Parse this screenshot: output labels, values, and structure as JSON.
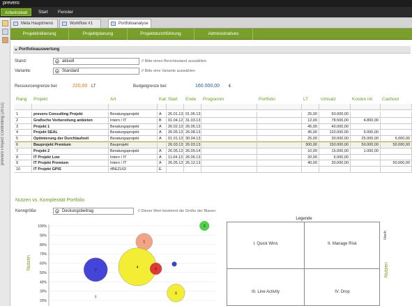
{
  "window": {
    "title": "prevero"
  },
  "menu": [
    {
      "label": "Arbeitsblatt",
      "active": true
    },
    {
      "label": "Start",
      "active": false
    },
    {
      "label": "Fenster",
      "active": false
    }
  ],
  "side": {
    "vertical_text": "prevero Project Controlling (2012)"
  },
  "tabs": [
    {
      "label": "Meta Hauptmenü",
      "selected": false
    },
    {
      "label": "Workflow #1",
      "selected": false
    },
    {
      "label": "Portfolioanalyse",
      "selected": true
    }
  ],
  "nav": [
    "Projektinitiierung",
    "Projektplanung",
    "Projektdurchführung",
    "Administratives"
  ],
  "section1": {
    "title": "Portfolioauswertung"
  },
  "filters": {
    "stand": {
      "label": "Stand:",
      "value": "aktuell",
      "hint": "// Bitte einen Berichtsstand auswählen"
    },
    "variante": {
      "label": "Variante:",
      "value": "Standard",
      "hint": "// Bitte eine Variante auswählen"
    }
  },
  "limits": {
    "ressourcen_label": "Ressourcengrenze bei:",
    "ressourcen_value": "220,00",
    "ressourcen_unit": "LT",
    "budget_label": "Budgetgrenze bei:",
    "budget_value": "160.000,00",
    "budget_unit": "€"
  },
  "table": {
    "columns": [
      "Rang",
      "Projekt",
      "Art",
      "Kat.",
      "Start",
      "Ende",
      "Programm",
      "Portfolio",
      "LT",
      "Umsatz",
      "Kosten int.",
      "Cashout"
    ],
    "rows": [
      [
        "1",
        "prevero Consulting Projekt",
        "Beratungsprojekt",
        "A",
        "26.01.13",
        "01.06.13",
        "",
        "",
        "25,00",
        "50.000,00",
        "",
        ""
      ],
      [
        "2",
        "Grafische Vorbereitung anbieten",
        "Intern / IT",
        "B",
        "01.04.12",
        "31.03.13",
        "",
        "",
        "12,00",
        "78.500,00",
        "4.800,00",
        ""
      ],
      [
        "3",
        "Projekt 1",
        "Beratungsprojekt",
        "A",
        "26.02.13",
        "26.06.13",
        "",
        "",
        "45,00",
        "40.000,00",
        "",
        ""
      ],
      [
        "4",
        "Projekt SEAL",
        "Beratungsprojekt",
        "A",
        "26.05.13",
        "26.08.13",
        "",
        "",
        "45,00",
        "120.000,00",
        "5.000,00",
        ""
      ],
      [
        "5",
        "Optimierung der Durchlaufzeit",
        "Beratungsprojekt",
        "A",
        "01.01.13",
        "30.04.13",
        "",
        "",
        "25,00",
        "30.000,00",
        "25.000,00",
        "5.000,00"
      ],
      [
        "6",
        "Bauprojekt Premium",
        "Bauprojekt",
        "",
        "26.03.13",
        "26.03.13",
        "",
        "",
        "300,00",
        "150.000,00",
        "50.000,00",
        "50.000,00"
      ],
      [
        "7",
        "Projekt 2",
        "Beratungsprojekt",
        "A",
        "26.05.13",
        "26.09.14",
        "",
        "",
        "10,00",
        "15.000,00",
        "1.000,00",
        ""
      ],
      [
        "8",
        "IT Projekt Low",
        "Intern / IT",
        "A",
        "11.04.13",
        "26.06.13",
        "",
        "",
        "20,00",
        "6.000,00",
        "",
        ""
      ],
      [
        "9",
        "IT Projekt Premium",
        "Intern / IT",
        "A",
        "26.05.13",
        "26.12.13",
        "",
        "",
        "40,00",
        "30.000,00",
        "",
        "50.000,00"
      ],
      [
        "10",
        "IT Projekt GPIS",
        "#BEZUG!",
        "E",
        "",
        "",
        "",
        "",
        "",
        "",
        "",
        ""
      ]
    ]
  },
  "section2": {
    "title": "Nutzen vs. Komplexität Portfolio",
    "kenngroesse_label": "Kenngröße",
    "kenngroesse_value": "Deckungsbeitrag",
    "kenngroesse_hint": "// Dieser Wert bestimmt die Größe der Blasen."
  },
  "chart_data": {
    "type": "scatter",
    "ylabel": "Nutzen",
    "yticks": [
      "100%",
      "90%",
      "80%",
      "70%",
      "60%",
      "50%",
      "40%",
      "30%",
      "20%"
    ],
    "ylim": [
      20,
      100
    ],
    "xlim": [
      0,
      100
    ],
    "points": [
      {
        "label": "3",
        "x": 93,
        "y": 100,
        "r": 4,
        "color": "#44d43a"
      },
      {
        "label": "1",
        "x": 57,
        "y": 83,
        "r": 7,
        "color": "#f3a07f"
      },
      {
        "label": "2",
        "x": 28,
        "y": 53,
        "r": 10,
        "color": "#3a3ad6"
      },
      {
        "label": "4",
        "x": 53,
        "y": 56,
        "r": 16,
        "color": "#f3ee2a"
      },
      {
        "label": "6",
        "x": 64,
        "y": 54,
        "r": 5,
        "color": "#e03030"
      },
      {
        "label": "",
        "x": 75,
        "y": 59,
        "r": 2,
        "color": "#2a3ad0"
      },
      {
        "label": "9",
        "x": 76,
        "y": 28,
        "r": 7.5,
        "color": "#f3ee2a"
      },
      {
        "label": "8",
        "x": 28,
        "y": 24,
        "r": 0,
        "color": "#3a8a2a"
      }
    ]
  },
  "legend": {
    "title": "Legende",
    "quadrants": [
      "I. Quick Wins",
      "II. Manage Risk",
      "III. Line Activity",
      "IV. Drop"
    ],
    "hoch": "Hoch",
    "nutzen": "Nutzen"
  },
  "colors": {
    "accent": "#789f28",
    "header_green": "#6a9a18",
    "orange": "#e07000",
    "blue": "#1f4fb0"
  }
}
